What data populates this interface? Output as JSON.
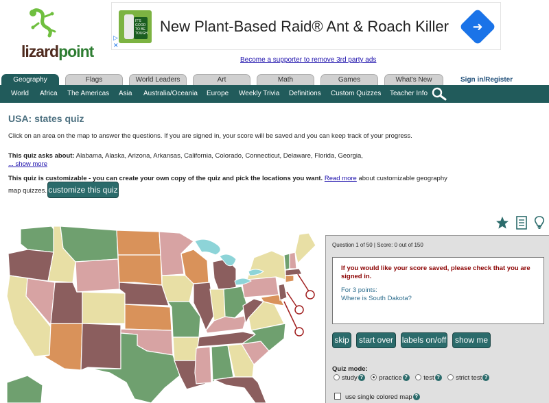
{
  "logo": {
    "text_a": "lizard",
    "text_b": "point"
  },
  "ad": {
    "headline": "New Plant-Based Raid® Ant & Roach Killer",
    "product_badge": "IT'S GOOD TO BE TOUGH",
    "arrow_icon": "directions-arrow-icon"
  },
  "supporter_link": "Become a supporter to remove 3rd party ads",
  "tabs": [
    {
      "label": "Geography",
      "active": true
    },
    {
      "label": "Flags",
      "active": false
    },
    {
      "label": "World Leaders",
      "active": false
    },
    {
      "label": "Art",
      "active": false
    },
    {
      "label": "Math",
      "active": false
    },
    {
      "label": "Games",
      "active": false
    },
    {
      "label": "What's New",
      "active": false
    }
  ],
  "signin": "Sign in/Register",
  "subnav": [
    "World",
    "Africa",
    "The Americas",
    "Asia",
    "Australia/Oceania",
    "Europe",
    "Weekly Trivia",
    "Definitions",
    "Custom Quizzes",
    "Teacher Info"
  ],
  "page": {
    "title": "USA: states quiz",
    "intro": "Click on an area on the map to answer the questions. If you are signed in, your score will be saved and you can keep track of your progress.",
    "asks_label": "This quiz asks about:",
    "asks_states": "Alabama, Alaska, Arizona, Arkansas, California, Colorado, Connecticut, Delaware, Florida, Georgia,",
    "show_more": "... show more",
    "customizable_bold": "This quiz is customizable - you can create your own copy of the quiz and pick the locations you want.",
    "read_more": "Read more",
    "customizable_rest": "about customizable geography",
    "customizable_line2": "map quizzes.",
    "customize_button": "customize this quiz"
  },
  "tool_icons": [
    "star-icon",
    "document-icon",
    "lightbulb-icon"
  ],
  "quiz": {
    "status": "Question 1 of 50 | Score: 0 out of 150",
    "warning_line1": "If you would like your score saved, please check that you are",
    "warning_line2": "signed in.",
    "points": "For 3 points:",
    "question": "Where is South Dakota?",
    "buttons": {
      "skip": "skip",
      "start_over": "start over",
      "labels": "labels on/off",
      "show_me": "show me"
    },
    "mode_label": "Quiz mode:",
    "modes": [
      {
        "label": "study",
        "selected": false
      },
      {
        "label": "practice",
        "selected": true
      },
      {
        "label": "test",
        "selected": false
      },
      {
        "label": "strict test",
        "selected": false
      }
    ],
    "single_color_label": "use single colored map",
    "single_color_checked": false
  },
  "colors": {
    "accent": "#215b5b",
    "brown": "#8b5e5e",
    "green": "#6fa06f",
    "tan": "#e8dfa5",
    "pink": "#d7a3a3",
    "orange": "#d9925a",
    "blue": "#8dc9d4",
    "lake": "#8dd4d8"
  }
}
